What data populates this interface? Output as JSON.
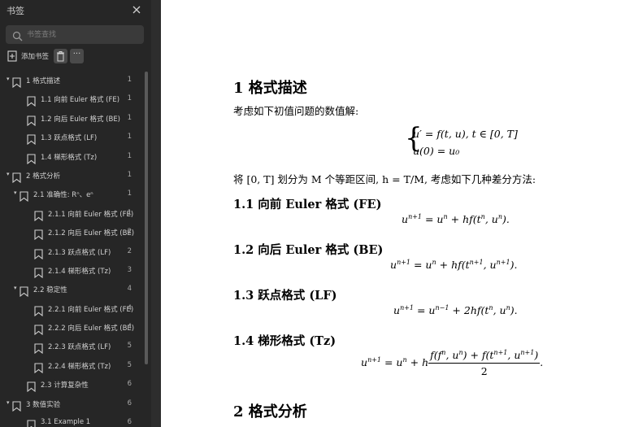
{
  "sidebar": {
    "title": "书签",
    "search_placeholder": "书签查找",
    "add_bookmark_label": "添加书签",
    "more_label": "···",
    "items": [
      {
        "label": "1 格式描述",
        "count": "1",
        "level": 0,
        "expandable": true
      },
      {
        "label": "1.1 向前 Euler 格式 (FE)",
        "count": "1",
        "level": 1,
        "expandable": false
      },
      {
        "label": "1.2 向后 Euler 格式 (BE)",
        "count": "1",
        "level": 1,
        "expandable": false
      },
      {
        "label": "1.3 跃点格式 (LF)",
        "count": "1",
        "level": 1,
        "expandable": false
      },
      {
        "label": "1.4 梯形格式 (Tz)",
        "count": "1",
        "level": 1,
        "expandable": false
      },
      {
        "label": "2 格式分析",
        "count": "1",
        "level": 0,
        "expandable": true
      },
      {
        "label": "2.1 准确性: Rⁿ、eⁿ",
        "count": "1",
        "level": 1,
        "expandable": true
      },
      {
        "label": "2.1.1 向前 Euler 格式 (FE)",
        "count": "1",
        "level": 2,
        "expandable": false
      },
      {
        "label": "2.1.2 向后 Euler 格式 (BE)",
        "count": "2",
        "level": 2,
        "expandable": false
      },
      {
        "label": "2.1.3 跃点格式 (LF)",
        "count": "2",
        "level": 2,
        "expandable": false
      },
      {
        "label": "2.1.4 梯形格式 (Tz)",
        "count": "3",
        "level": 2,
        "expandable": false
      },
      {
        "label": "2.2 稳定性",
        "count": "4",
        "level": 1,
        "expandable": true
      },
      {
        "label": "2.2.1 向前 Euler 格式 (FE)",
        "count": "4",
        "level": 2,
        "expandable": false
      },
      {
        "label": "2.2.2 向后 Euler 格式 (BE)",
        "count": "4",
        "level": 2,
        "expandable": false
      },
      {
        "label": "2.2.3 跃点格式 (LF)",
        "count": "5",
        "level": 2,
        "expandable": false
      },
      {
        "label": "2.2.4 梯形格式 (Tz)",
        "count": "5",
        "level": 2,
        "expandable": false
      },
      {
        "label": "2.3 计算复杂性",
        "count": "6",
        "level": 1,
        "expandable": false
      },
      {
        "label": "3 数值实验",
        "count": "6",
        "level": 0,
        "expandable": true
      },
      {
        "label": "3.1 Example 1",
        "count": "6",
        "level": 1,
        "expandable": false
      }
    ]
  },
  "document": {
    "section1_title": "1 格式描述",
    "intro": "考虑如下初值问题的数值解:",
    "system_line1": "u′ = f(t, u),  t ∈ [0, T]",
    "system_line2": "u(0) = u₀",
    "partition": "将 [0, T] 划分为 M 个等距区间,  h = T/M,  考虑如下几种差分方法:",
    "fe_title": "1.1 向前 Euler 格式 (FE)",
    "be_title": "1.2 向后 Euler 格式 (BE)",
    "lf_title": "1.3 跃点格式 (LF)",
    "tz_title": "1.4 梯形格式 (Tz)",
    "section2_title": "2 格式分析"
  }
}
